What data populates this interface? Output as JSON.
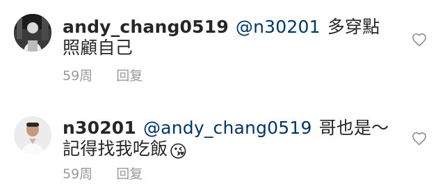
{
  "comments": [
    {
      "username": "andy_chang0519",
      "mention": "@n30201",
      "text": "多穿點 照顧自己",
      "emoji": "",
      "time": "59周",
      "reply_label": "回复",
      "avatar_icon": "avatar-photo-dark",
      "like_icon": "heart-outline-icon"
    },
    {
      "username": "n30201",
      "mention": "@andy_chang0519",
      "text": "哥也是～記得找我吃飯",
      "emoji": "😘",
      "time": "59周",
      "reply_label": "回复",
      "avatar_icon": "avatar-photo-light",
      "like_icon": "heart-outline-icon"
    }
  ],
  "colors": {
    "text": "#262626",
    "mention": "#003569",
    "meta": "#999999",
    "background": "#ffffff"
  }
}
